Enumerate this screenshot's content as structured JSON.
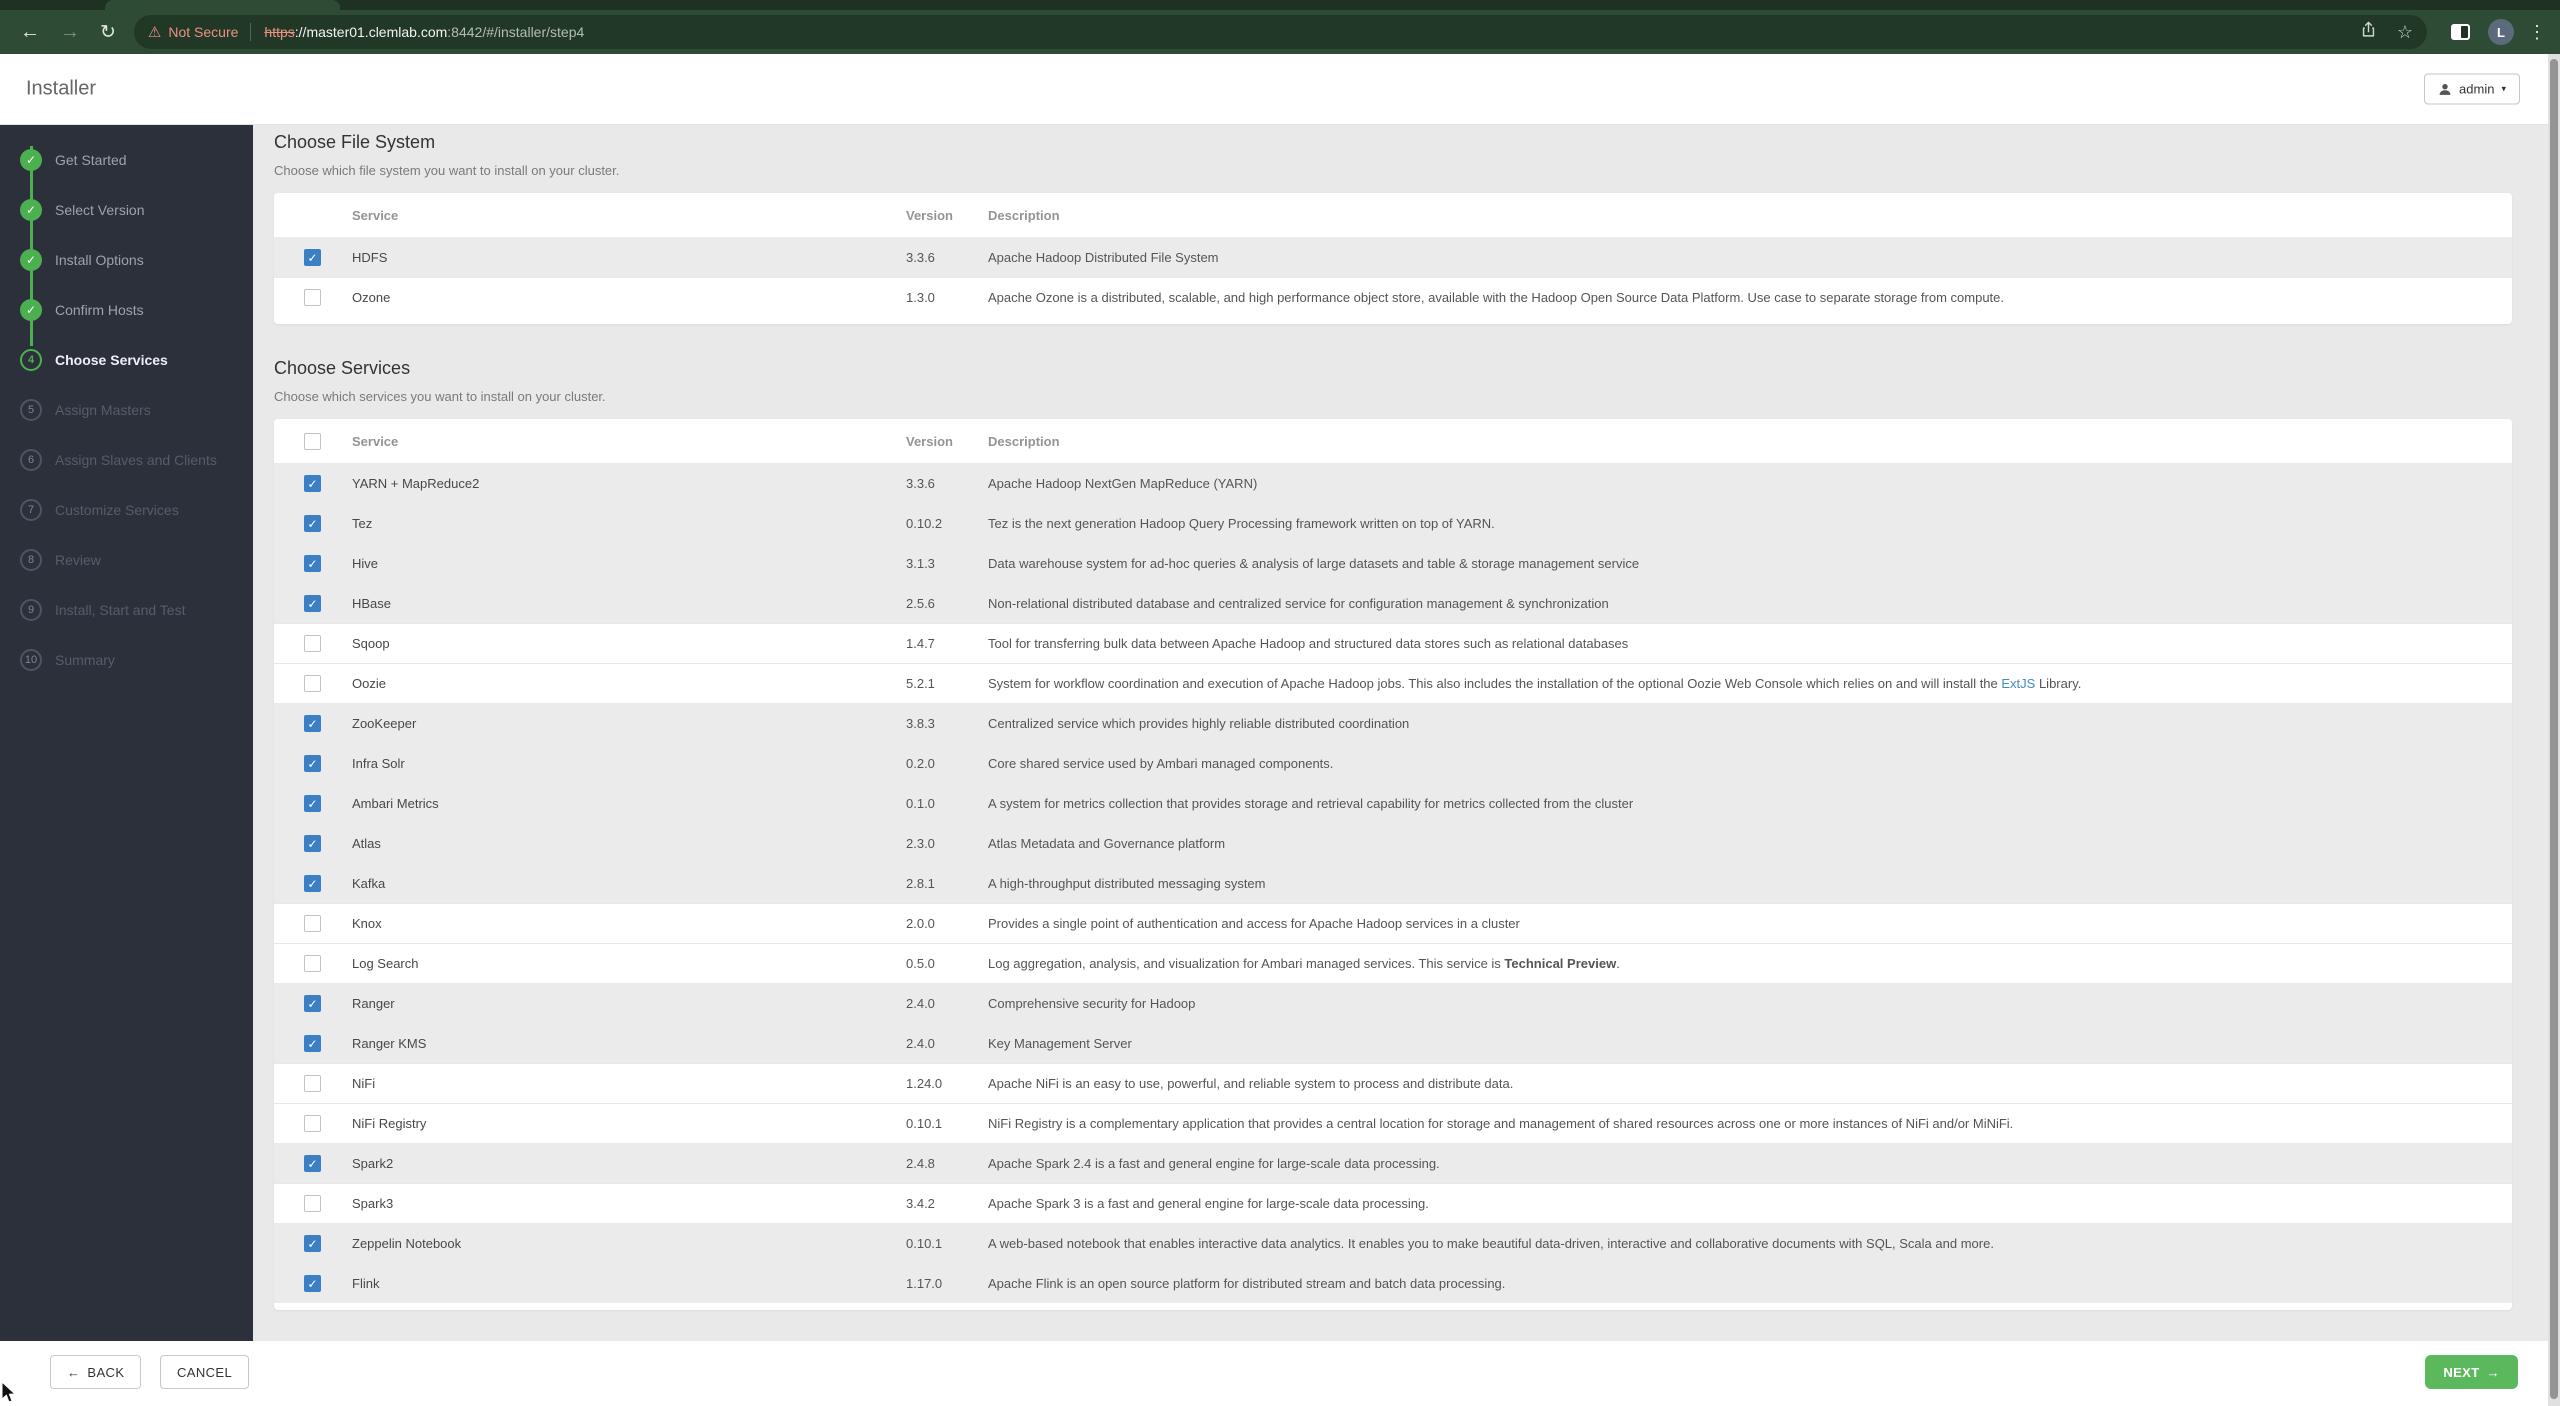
{
  "browser": {
    "security_label": "Not Secure",
    "url": {
      "scheme": "https",
      "host": "://master01.clemlab.com",
      "path": ":8442/#/installer/step4"
    },
    "avatar_letter": "L"
  },
  "header": {
    "title": "Installer",
    "user_button": "admin"
  },
  "sidebar": {
    "steps": [
      {
        "label": "Get Started",
        "state": "done",
        "number": ""
      },
      {
        "label": "Select Version",
        "state": "done",
        "number": ""
      },
      {
        "label": "Install Options",
        "state": "done",
        "number": ""
      },
      {
        "label": "Confirm Hosts",
        "state": "done",
        "number": ""
      },
      {
        "label": "Choose Services",
        "state": "current",
        "number": "4"
      },
      {
        "label": "Assign Masters",
        "state": "todo",
        "number": "5"
      },
      {
        "label": "Assign Slaves and Clients",
        "state": "todo",
        "number": "6"
      },
      {
        "label": "Customize Services",
        "state": "todo",
        "number": "7"
      },
      {
        "label": "Review",
        "state": "todo",
        "number": "8"
      },
      {
        "label": "Install, Start and Test",
        "state": "todo",
        "number": "9"
      },
      {
        "label": "Summary",
        "state": "todo",
        "number": "10"
      }
    ]
  },
  "fs": {
    "title": "Choose File System",
    "subtitle": "Choose which file system you want to install on your cluster.",
    "columns": [
      "Service",
      "Version",
      "Description"
    ],
    "rows": [
      {
        "name": "HDFS",
        "version": "3.3.6",
        "checked": true,
        "desc": [
          {
            "t": "Apache Hadoop Distributed File System",
            "s": "normal"
          }
        ]
      },
      {
        "name": "Ozone",
        "version": "1.3.0",
        "checked": false,
        "desc": [
          {
            "t": "Apache Ozone is a distributed, scalable, and high performance object store, available with the Hadoop Open Source Data Platform. Use case to separate storage from compute.",
            "s": "normal"
          }
        ]
      }
    ]
  },
  "svc": {
    "title": "Choose Services",
    "subtitle": "Choose which services you want to install on your cluster.",
    "columns": [
      "Service",
      "Version",
      "Description"
    ],
    "rows": [
      {
        "name": "YARN + MapReduce2",
        "version": "3.3.6",
        "checked": true,
        "desc": [
          {
            "t": "Apache Hadoop NextGen MapReduce (YARN)",
            "s": "normal"
          }
        ]
      },
      {
        "name": "Tez",
        "version": "0.10.2",
        "checked": true,
        "desc": [
          {
            "t": "Tez is the next generation Hadoop Query Processing framework written on top of YARN.",
            "s": "normal"
          }
        ]
      },
      {
        "name": "Hive",
        "version": "3.1.3",
        "checked": true,
        "desc": [
          {
            "t": "Data warehouse system for ad-hoc queries & analysis of large datasets and table & storage management service",
            "s": "normal"
          }
        ]
      },
      {
        "name": "HBase",
        "version": "2.5.6",
        "checked": true,
        "desc": [
          {
            "t": "Non-relational distributed database and centralized service for configuration management & synchronization",
            "s": "normal"
          }
        ]
      },
      {
        "name": "Sqoop",
        "version": "1.4.7",
        "checked": false,
        "desc": [
          {
            "t": "Tool for transferring bulk data between Apache Hadoop and structured data stores such as relational databases",
            "s": "normal"
          }
        ]
      },
      {
        "name": "Oozie",
        "version": "5.2.1",
        "checked": false,
        "desc": [
          {
            "t": "System for workflow coordination and execution of Apache Hadoop jobs. This also includes the installation of the optional Oozie Web Console which relies on and will install the ",
            "s": "normal"
          },
          {
            "t": "ExtJS",
            "s": "link"
          },
          {
            "t": " Library.",
            "s": "normal"
          }
        ]
      },
      {
        "name": "ZooKeeper",
        "version": "3.8.3",
        "checked": true,
        "desc": [
          {
            "t": "Centralized service which provides highly reliable distributed coordination",
            "s": "normal"
          }
        ]
      },
      {
        "name": "Infra Solr",
        "version": "0.2.0",
        "checked": true,
        "desc": [
          {
            "t": "Core shared service used by Ambari managed components.",
            "s": "normal"
          }
        ]
      },
      {
        "name": "Ambari Metrics",
        "version": "0.1.0",
        "checked": true,
        "desc": [
          {
            "t": "A system for metrics collection that provides storage and retrieval capability for metrics collected from the cluster",
            "s": "normal"
          }
        ]
      },
      {
        "name": "Atlas",
        "version": "2.3.0",
        "checked": true,
        "desc": [
          {
            "t": "Atlas Metadata and Governance platform",
            "s": "normal"
          }
        ]
      },
      {
        "name": "Kafka",
        "version": "2.8.1",
        "checked": true,
        "desc": [
          {
            "t": "A high-throughput distributed messaging system",
            "s": "normal"
          }
        ]
      },
      {
        "name": "Knox",
        "version": "2.0.0",
        "checked": false,
        "desc": [
          {
            "t": "Provides a single point of authentication and access for Apache Hadoop services in a cluster",
            "s": "normal"
          }
        ]
      },
      {
        "name": "Log Search",
        "version": "0.5.0",
        "checked": false,
        "desc": [
          {
            "t": "Log aggregation, analysis, and visualization for Ambari managed services. This service is ",
            "s": "normal"
          },
          {
            "t": "Technical Preview",
            "s": "bold"
          },
          {
            "t": ".",
            "s": "normal"
          }
        ]
      },
      {
        "name": "Ranger",
        "version": "2.4.0",
        "checked": true,
        "desc": [
          {
            "t": "Comprehensive security for Hadoop",
            "s": "normal"
          }
        ]
      },
      {
        "name": "Ranger KMS",
        "version": "2.4.0",
        "checked": true,
        "desc": [
          {
            "t": "Key Management Server",
            "s": "normal"
          }
        ]
      },
      {
        "name": "NiFi",
        "version": "1.24.0",
        "checked": false,
        "desc": [
          {
            "t": "Apache NiFi is an easy to use, powerful, and reliable system to process and distribute data.",
            "s": "normal"
          }
        ]
      },
      {
        "name": "NiFi Registry",
        "version": "0.10.1",
        "checked": false,
        "desc": [
          {
            "t": "NiFi Registry is a complementary application that provides a central location for storage and management of shared resources across one or more instances of NiFi and/or MiNiFi.",
            "s": "normal"
          }
        ]
      },
      {
        "name": "Spark2",
        "version": "2.4.8",
        "checked": true,
        "desc": [
          {
            "t": "Apache Spark 2.4 is a fast and general engine for large-scale data processing.",
            "s": "normal"
          }
        ]
      },
      {
        "name": "Spark3",
        "version": "3.4.2",
        "checked": false,
        "desc": [
          {
            "t": "Apache Spark 3 is a fast and general engine for large-scale data processing.",
            "s": "normal"
          }
        ]
      },
      {
        "name": "Zeppelin Notebook",
        "version": "0.10.1",
        "checked": true,
        "desc": [
          {
            "t": "A web-based notebook that enables interactive data analytics. It enables you to make beautiful data-driven, interactive and collaborative documents with SQL, Scala and more.",
            "s": "normal"
          }
        ]
      },
      {
        "name": "Flink",
        "version": "1.17.0",
        "checked": true,
        "desc": [
          {
            "t": "Apache Flink is an open source platform for distributed stream and batch data processing.",
            "s": "normal"
          }
        ]
      }
    ]
  },
  "footer": {
    "back_arrow": "←",
    "back_label": "BACK",
    "cancel_label": "CANCEL",
    "next_label": "NEXT",
    "next_arrow": "→"
  },
  "icons": {
    "back": "←",
    "forward": "→",
    "reload": "↻",
    "warning": "⚠",
    "star": "☆",
    "dots": "⋮",
    "caret": "▼"
  },
  "colors": {
    "chrome_green": "#2e4b36",
    "omnibox_green": "#223827",
    "sidebar_navy": "#2b303b",
    "accent_green": "#4caf50",
    "next_green": "#5cb85c",
    "checkbox_blue": "#3b80c4",
    "link_blue": "#428bca",
    "warning_salmon": "#ec8f84"
  }
}
